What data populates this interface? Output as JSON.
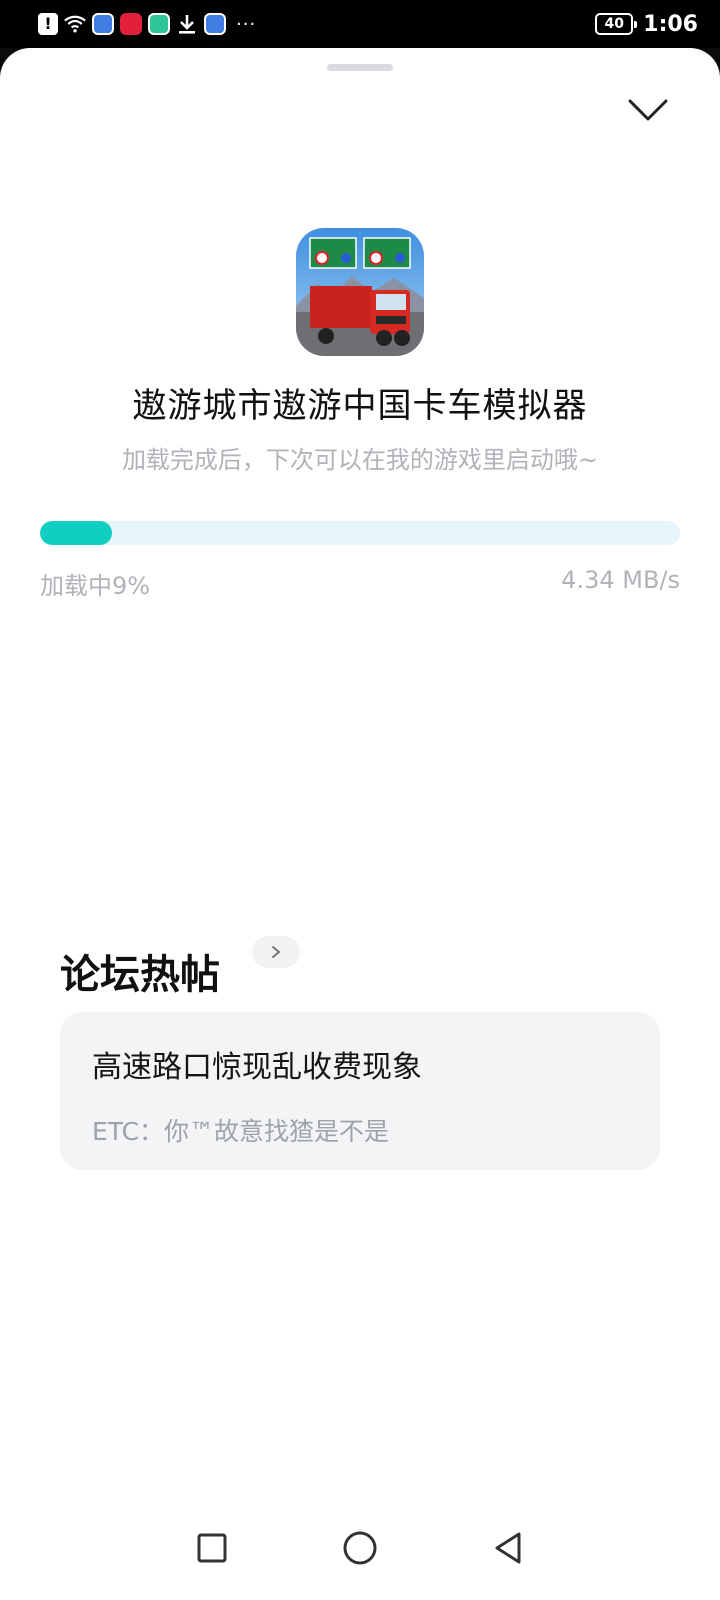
{
  "status_bar": {
    "time": "1:06",
    "battery": "40",
    "overflow": "···",
    "icons": [
      "notification-alert-icon",
      "wifi-icon",
      "browser-app-icon",
      "shopping-app-icon",
      "chat-app-icon",
      "download-icon",
      "browser-app-icon"
    ]
  },
  "loader": {
    "game_title": "遨游城市遨游中国卡车模拟器",
    "subtitle": "加载完成后，下次可以在我的游戏里启动哦~",
    "progress_percent": 9,
    "progress_label": "加载中9%",
    "speed": "4.34 MB/s"
  },
  "forum": {
    "section_title": "论坛热帖",
    "posts": [
      {
        "title": "高速路口惊现乱收费现象",
        "excerpt": "ETC：你™故意找猹是不是"
      }
    ]
  },
  "nav": {
    "icons": [
      "recent-apps-icon",
      "home-icon",
      "back-icon"
    ]
  },
  "colors": {
    "progress_fill": "#10cfc1",
    "progress_track": "#e6f4fb",
    "muted_text": "#b0b3b8"
  }
}
